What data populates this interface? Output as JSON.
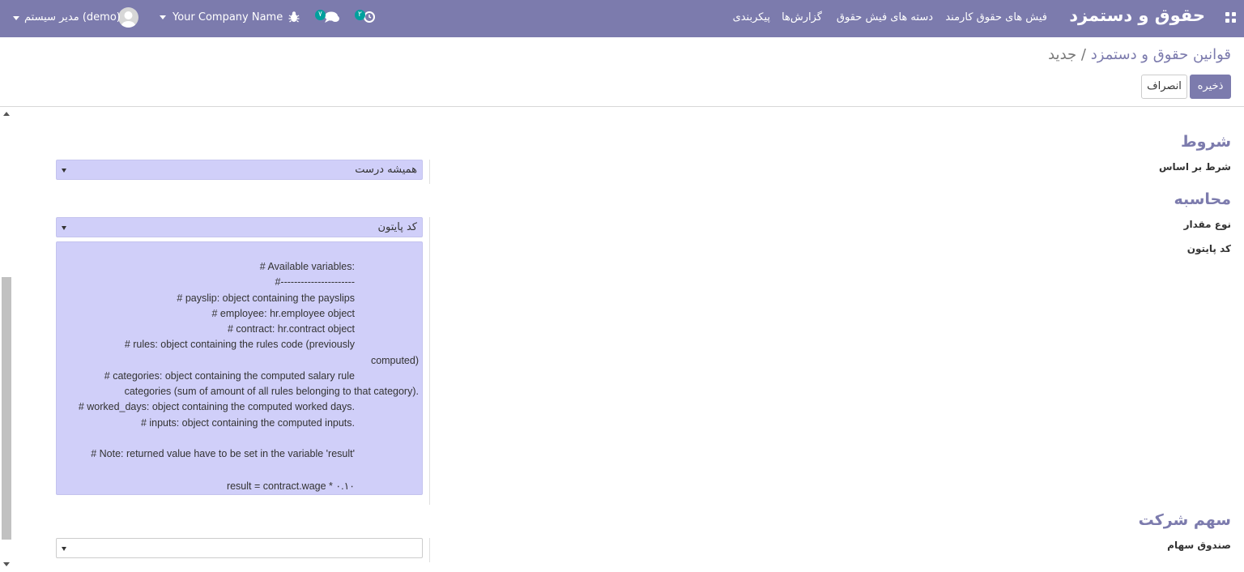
{
  "navbar": {
    "brand": "حقوق و دستمزد",
    "menu": [
      "فیش های حقوق کارمند",
      "دسته های فیش حقوق",
      "گزارش‌ها",
      "پیکربندی"
    ],
    "chat_badge": "۷",
    "activity_badge": "۲",
    "company": "Your Company Name",
    "user": "مدیر سیستم (demo)"
  },
  "breadcrumb": {
    "parent": "قوانین حقوق و دستمزد",
    "separator": "/",
    "current": "جدید"
  },
  "buttons": {
    "save": "ذخیره",
    "discard": "انصراف"
  },
  "form": {
    "conditions": {
      "title": "شروط",
      "condition_based_on_label": "شرط بر اساس",
      "condition_based_on_value": "همیشه درست"
    },
    "computation": {
      "title": "محاسبه",
      "amount_type_label": "نوع مقدار",
      "amount_type_value": "کد پایتون",
      "python_code_label": "کد پایتون",
      "python_code_lines": [
        "# Available variables:",
        "#----------------------",
        "# payslip: object containing the payslips",
        "# employee: hr.employee object",
        "# contract: hr.contract object",
        "# rules: object containing the rules code (previously",
        "computed)",
        "# categories: object containing the computed salary rule",
        "categories (sum of amount of all rules belonging to that category).",
        "# worked_days: object containing the computed worked days.",
        "# inputs: object containing the computed inputs.",
        "",
        "# Note: returned value have to be set in the variable 'result'",
        "",
        "result = contract.wage * ۰.۱۰"
      ]
    },
    "company_contribution": {
      "title": "سهم شرکت",
      "contribution_register_label": "صندوق سهام",
      "contribution_register_value": ""
    }
  },
  "colors": {
    "primary": "#7c7bad",
    "field_bg": "#d0cff9",
    "badge": "#00a09d"
  }
}
